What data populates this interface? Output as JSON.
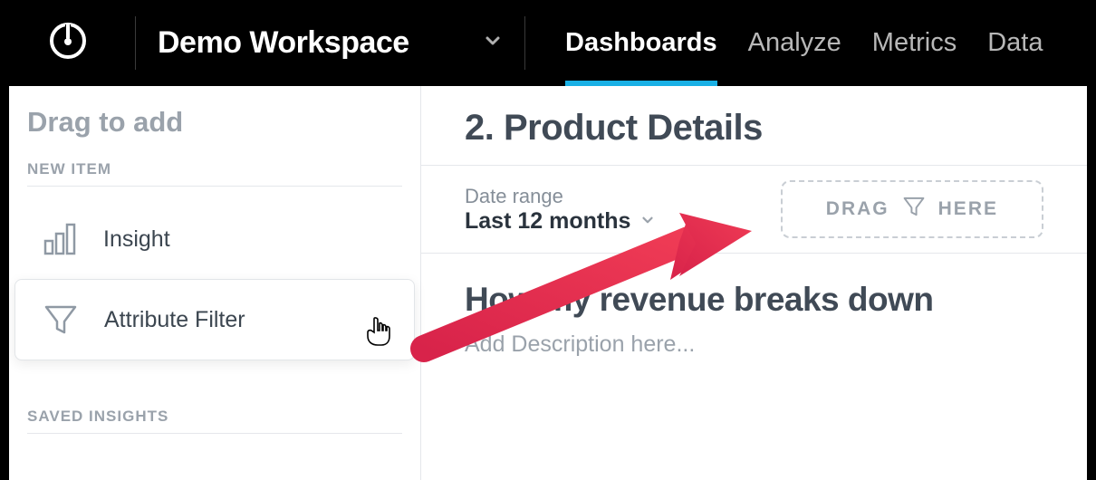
{
  "header": {
    "workspace_name": "Demo Workspace",
    "nav": [
      {
        "label": "Dashboards",
        "active": true
      },
      {
        "label": "Analyze",
        "active": false
      },
      {
        "label": "Metrics",
        "active": false
      },
      {
        "label": "Data",
        "active": false
      }
    ]
  },
  "sidebar": {
    "title": "Drag to add",
    "new_item_heading": "NEW ITEM",
    "items": [
      {
        "label": "Insight"
      },
      {
        "label": "Attribute Filter"
      }
    ],
    "saved_insights_heading": "SAVED INSIGHTS"
  },
  "main": {
    "page_title": "2. Product Details",
    "date_range": {
      "label": "Date range",
      "value": "Last 12 months"
    },
    "drop_zone": {
      "left": "DRAG",
      "right": "HERE"
    },
    "widget": {
      "title": "How my revenue breaks down",
      "description_placeholder": "Add Description here..."
    }
  }
}
